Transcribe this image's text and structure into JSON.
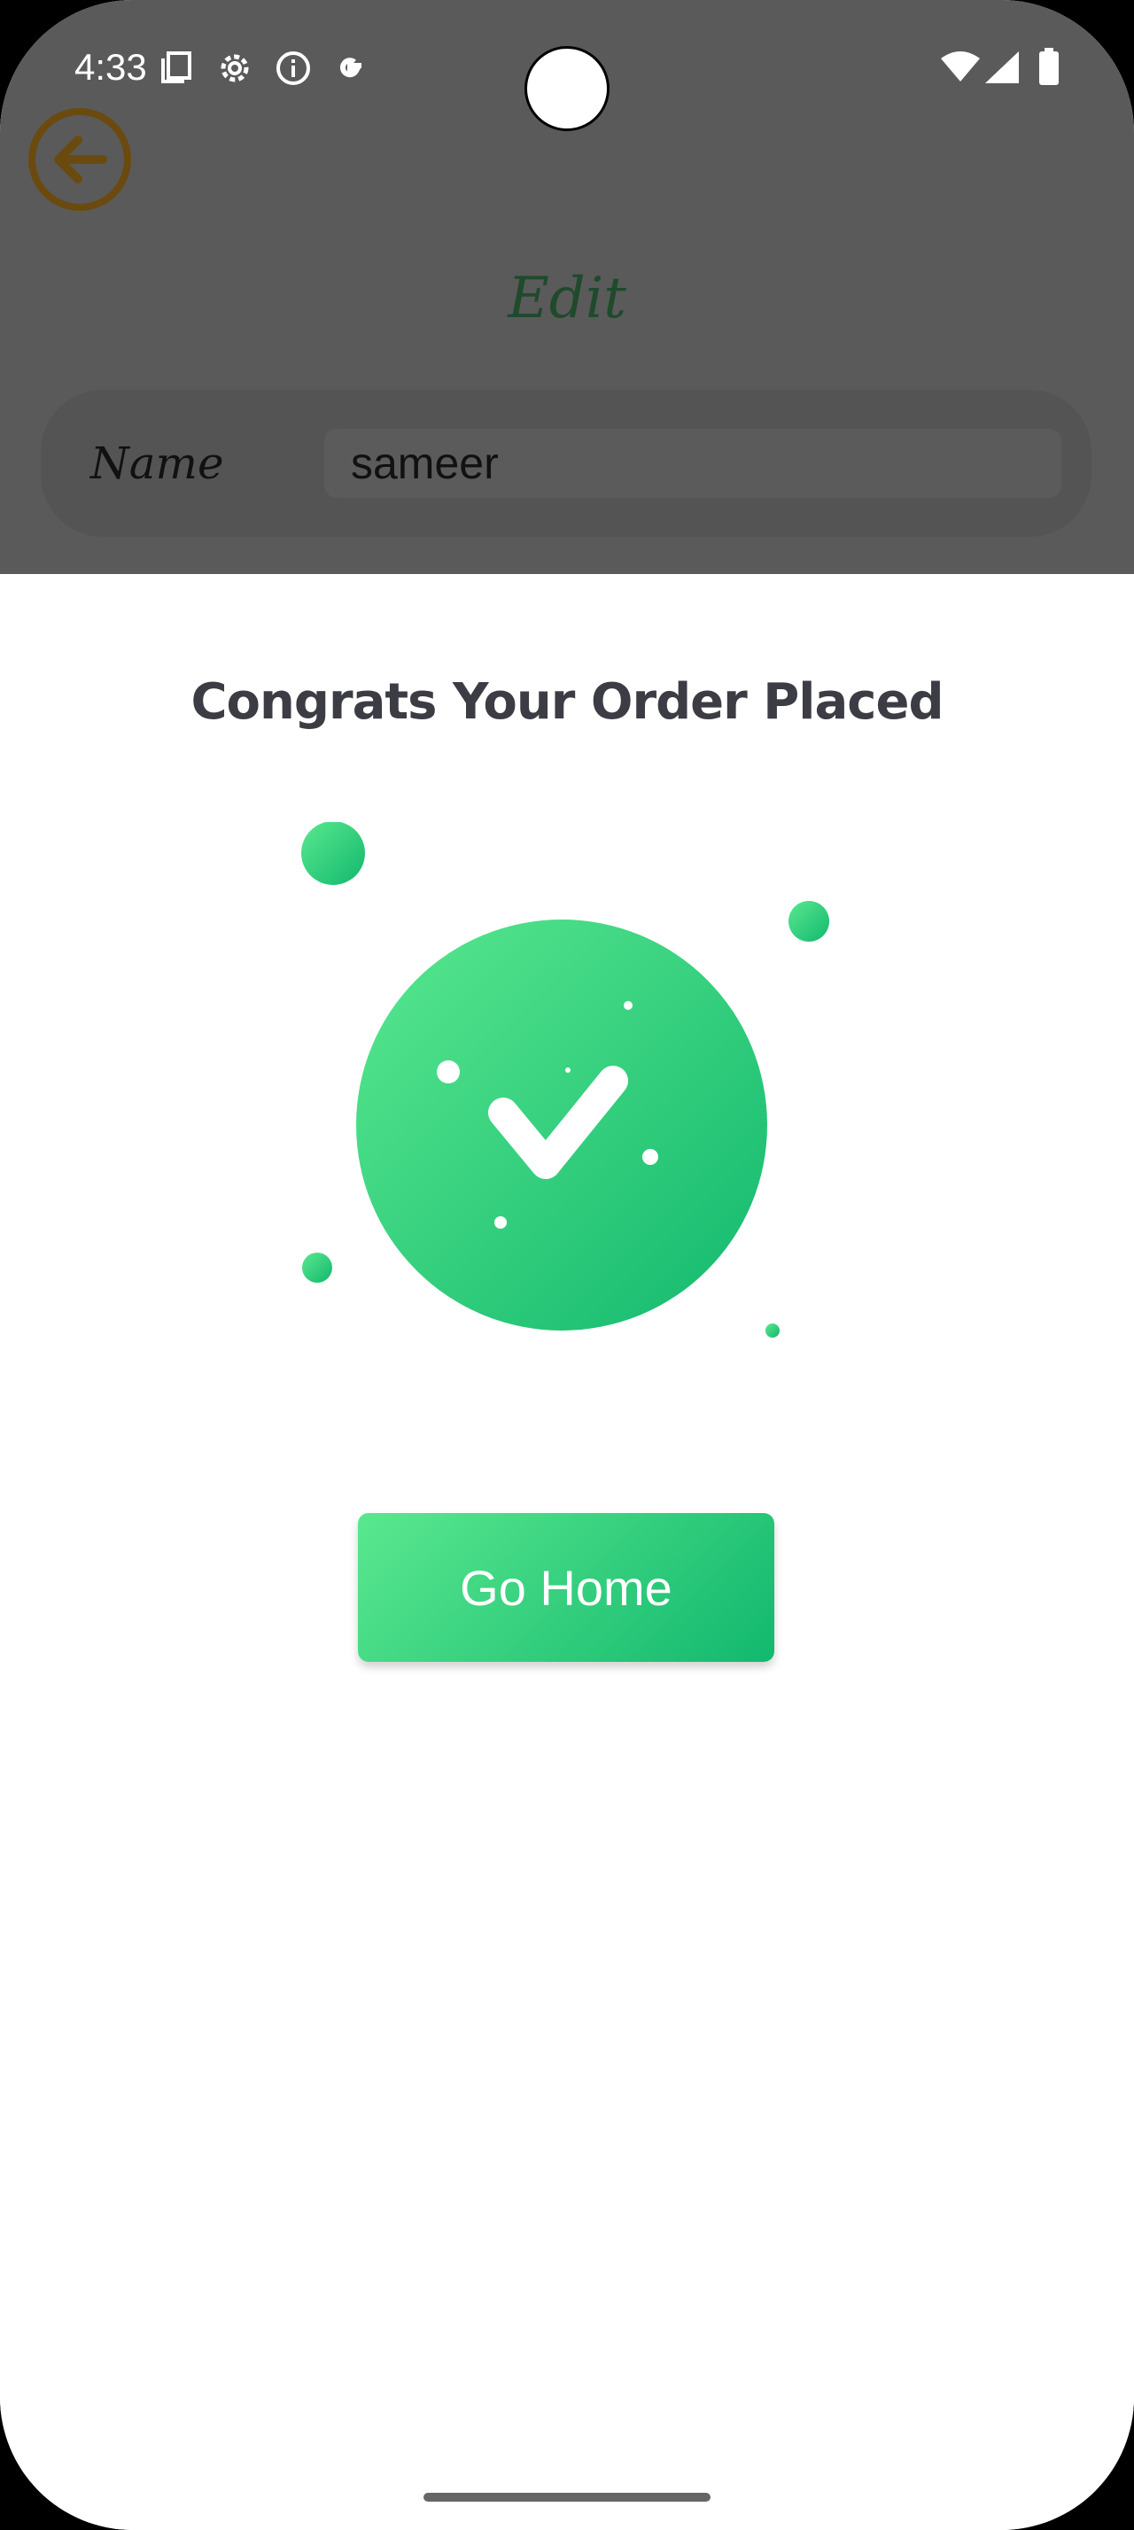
{
  "status_bar": {
    "time": "4:33",
    "icons": [
      "copy-icon",
      "settings-gear-icon",
      "info-icon",
      "google-icon"
    ],
    "right_icons": [
      "wifi-icon",
      "signal-icon",
      "battery-icon"
    ]
  },
  "background_page": {
    "title": "Edit",
    "name_label": "Name",
    "name_value": "sameer",
    "back_icon": "arrow-left-circle-icon"
  },
  "dialog": {
    "heading": "Congrats Your Order Placed",
    "illustration_icon": "check-circle-icon",
    "button_label": "Go Home"
  },
  "colors": {
    "accent_green": "#2ccf7c",
    "back_icon_color": "#6b4a10",
    "heading_color": "#3c3c44"
  }
}
